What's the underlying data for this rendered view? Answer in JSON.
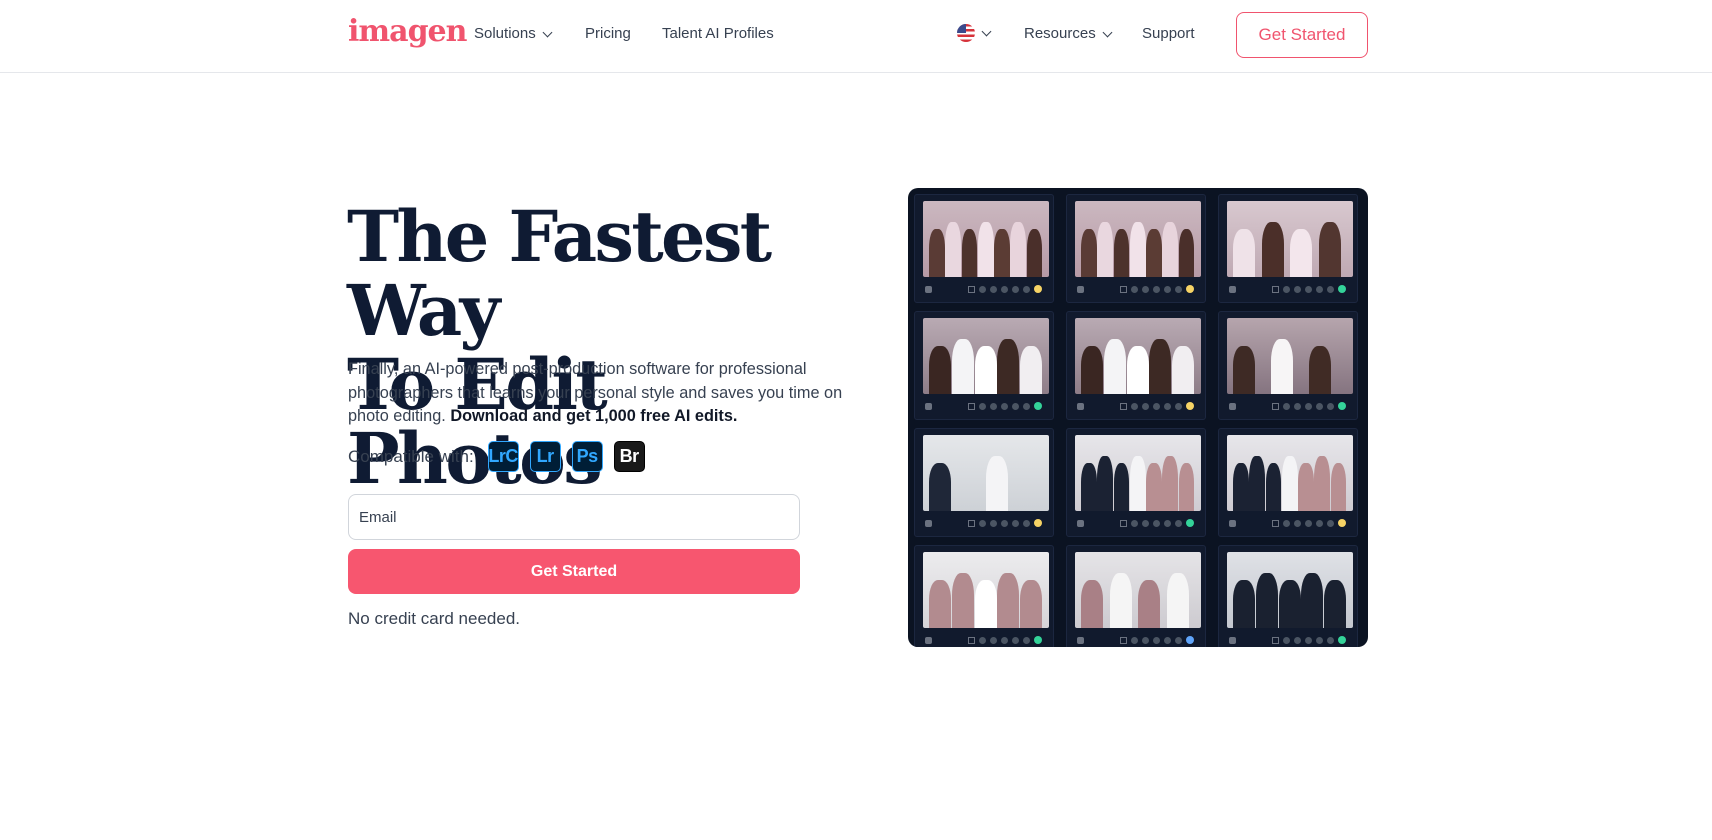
{
  "header": {
    "logo": "imagen",
    "nav_left": [
      {
        "label": "Solutions",
        "has_dropdown": true
      },
      {
        "label": "Pricing",
        "has_dropdown": false
      },
      {
        "label": "Talent AI Profiles",
        "has_dropdown": false
      }
    ],
    "nav_right": [
      {
        "label": "Resources",
        "has_dropdown": true
      },
      {
        "label": "Support",
        "has_dropdown": false
      }
    ],
    "language_flag": "us-flag-icon",
    "cta_label": "Get Started"
  },
  "hero": {
    "title": "The Fastest Way\nTo Edit Photos",
    "description": "Finally, an AI-powered post-production software for professional photographers that learns your personal style and saves you time on photo editing.",
    "description_bold": "Download and get 1,000 free AI edits.",
    "compatible_label": "Compatible with:",
    "apps": [
      "LrC",
      "Lr",
      "Ps",
      "Br"
    ],
    "email_placeholder": "Email",
    "email_value": "",
    "cta_label": "Get Started",
    "note": "No credit card needed."
  },
  "photo_grid": {
    "colors": {
      "accent": "#f7566f",
      "panel": "#0b1322"
    },
    "tiles": [
      {
        "scene": "bridesmaids-robes",
        "status": "#f6d365"
      },
      {
        "scene": "bridesmaids-robes",
        "status": "#f6d365"
      },
      {
        "scene": "bride-robes",
        "status": "#34d399"
      },
      {
        "scene": "bride-dress-group",
        "status": "#34d399"
      },
      {
        "scene": "bride-dress-group",
        "status": "#f6d365"
      },
      {
        "scene": "bride-portrait",
        "status": "#34d399"
      },
      {
        "scene": "couple-dance",
        "status": "#f6d365"
      },
      {
        "scene": "wedding-party-hall",
        "status": "#34d399"
      },
      {
        "scene": "wedding-party-hall",
        "status": "#f6d365"
      },
      {
        "scene": "bridesmaids-bouquets",
        "status": "#34d399"
      },
      {
        "scene": "bridesmaids-bouquets-close",
        "status": "#60a5fa"
      },
      {
        "scene": "groomsmen",
        "status": "#34d399"
      }
    ]
  }
}
